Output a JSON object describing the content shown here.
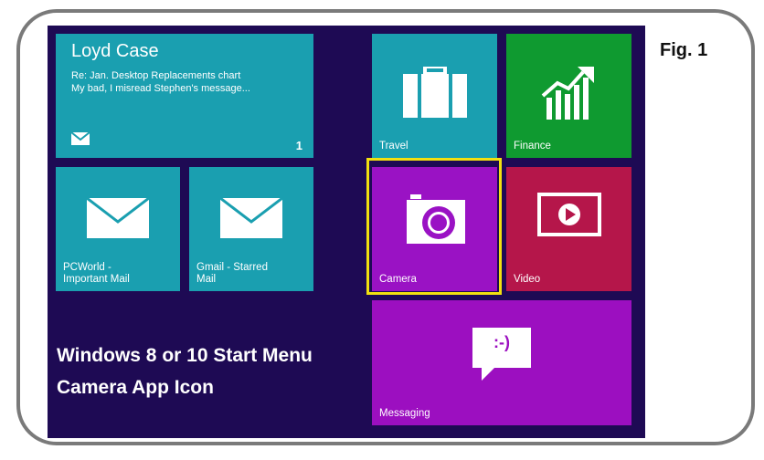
{
  "figure_label": "Fig. 1",
  "caption": {
    "line1": "Windows 8 or 10 Start Menu",
    "line2": "Camera App Icon"
  },
  "tiles": {
    "loyd": {
      "name": "Loyd Case",
      "subject": "Re: Jan. Desktop Replacements chart",
      "preview": "My bad, I misread Stephen's message...",
      "count": "1",
      "icon": "mail-icon"
    },
    "travel": {
      "label": "Travel",
      "icon": "suitcase-icon"
    },
    "finance": {
      "label": "Finance",
      "icon": "chart-icon"
    },
    "pcworld": {
      "label1": "PCWorld -",
      "label2": "Important Mail",
      "icon": "mail-icon"
    },
    "gmail": {
      "label1": "Gmail - Starred",
      "label2": "Mail",
      "icon": "mail-icon"
    },
    "camera": {
      "label": "Camera",
      "icon": "camera-icon",
      "highlighted": true
    },
    "video": {
      "label": "Video",
      "icon": "video-icon"
    },
    "messaging": {
      "label": "Messaging",
      "icon": "chat-bubble-icon",
      "emoticon": ":-)"
    }
  },
  "colors": {
    "background": "#1e0a54",
    "teal": "#1a9fb0",
    "green": "#0f9a30",
    "purple": "#9a12c4",
    "crimson": "#b5164a",
    "highlight": "#f2e010"
  }
}
